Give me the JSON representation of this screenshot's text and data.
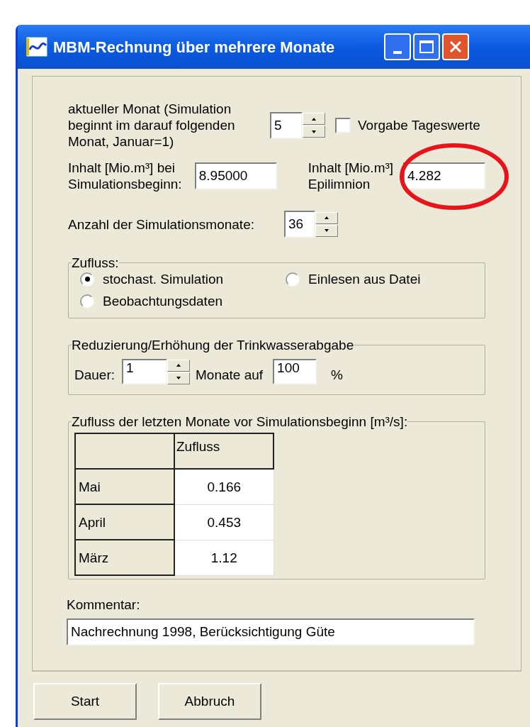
{
  "window": {
    "title": "MBM-Rechnung über mehrere Monate"
  },
  "current_month": {
    "label": "aktueller Monat (Simulation\nbeginnt im darauf folgenden\nMonat, Januar=1)",
    "value": "5"
  },
  "daily_values": {
    "label": "Vorgabe Tageswerte",
    "checked": false
  },
  "content_start": {
    "label": "Inhalt [Mio.m³] bei\nSimulationsbeginn:",
    "value": "8.95000"
  },
  "content_epilimnion": {
    "label": "Inhalt [Mio.m³]\nEpilimnion",
    "value": "4.282",
    "highlighted": true
  },
  "simulation_months": {
    "label": "Anzahl der Simulationsmonate:",
    "value": "36"
  },
  "inflow": {
    "title": "Zufluss:",
    "options": [
      {
        "label": "stochast. Simulation",
        "selected": true
      },
      {
        "label": "Einlesen aus Datei",
        "selected": false
      },
      {
        "label": "Beobachtungsdaten",
        "selected": false
      }
    ]
  },
  "drinking_water": {
    "title": "Reduzierung/Erhöhung der Trinkwasserabgabe",
    "duration_label": "Dauer:",
    "duration": "1",
    "months_label": "Monate auf",
    "percent": "100",
    "unit": "%"
  },
  "inflow_table": {
    "title": "Zufluss der letzten Monate vor Simulationsbeginn [m³/s]:",
    "columns": [
      "Zufluss"
    ],
    "rows": [
      {
        "month": "Mai",
        "value": "0.166"
      },
      {
        "month": "April",
        "value": "0.453"
      },
      {
        "month": "März",
        "value": "1.12"
      }
    ]
  },
  "comment": {
    "label": "Kommentar:",
    "value": "Nachrechnung 1998, Berücksichtigung Güte"
  },
  "buttons": [
    "Start",
    "Abbruch"
  ]
}
